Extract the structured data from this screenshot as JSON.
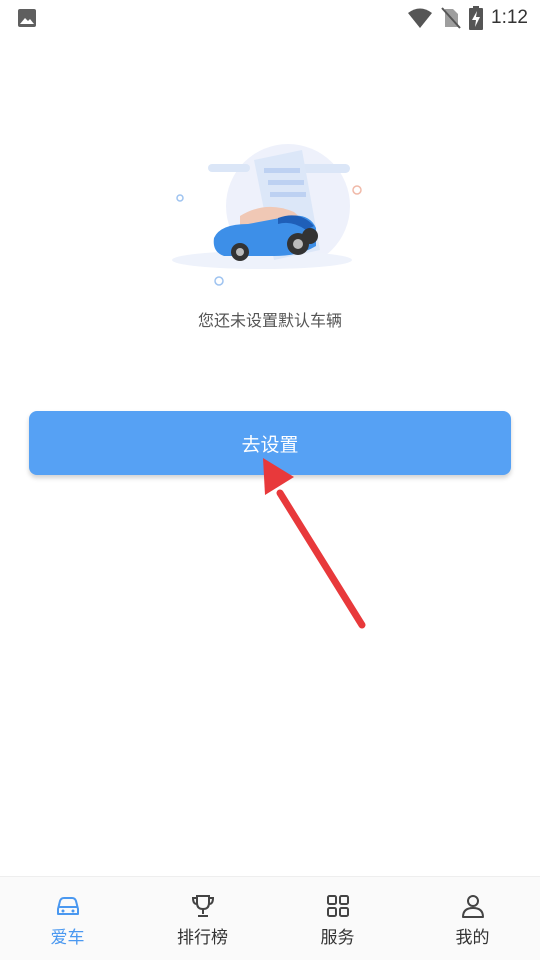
{
  "status_bar": {
    "time": "1:12",
    "icons": [
      "image-icon",
      "wifi-icon",
      "no-sim-icon",
      "battery-charging-icon"
    ]
  },
  "empty_state": {
    "illustration": "car-document-illustration",
    "message": "您还未设置默认车辆"
  },
  "primary_action": {
    "label": "去设置"
  },
  "bottom_nav": {
    "items": [
      {
        "label": "爱车",
        "icon": "car-icon",
        "active": true
      },
      {
        "label": "排行榜",
        "icon": "trophy-icon",
        "active": false
      },
      {
        "label": "服务",
        "icon": "grid-icon",
        "active": false
      },
      {
        "label": "我的",
        "icon": "person-icon",
        "active": false
      }
    ]
  },
  "colors": {
    "accent": "#56a1f4",
    "nav_active": "#4a98f0",
    "annotation_arrow": "#e8393b"
  }
}
